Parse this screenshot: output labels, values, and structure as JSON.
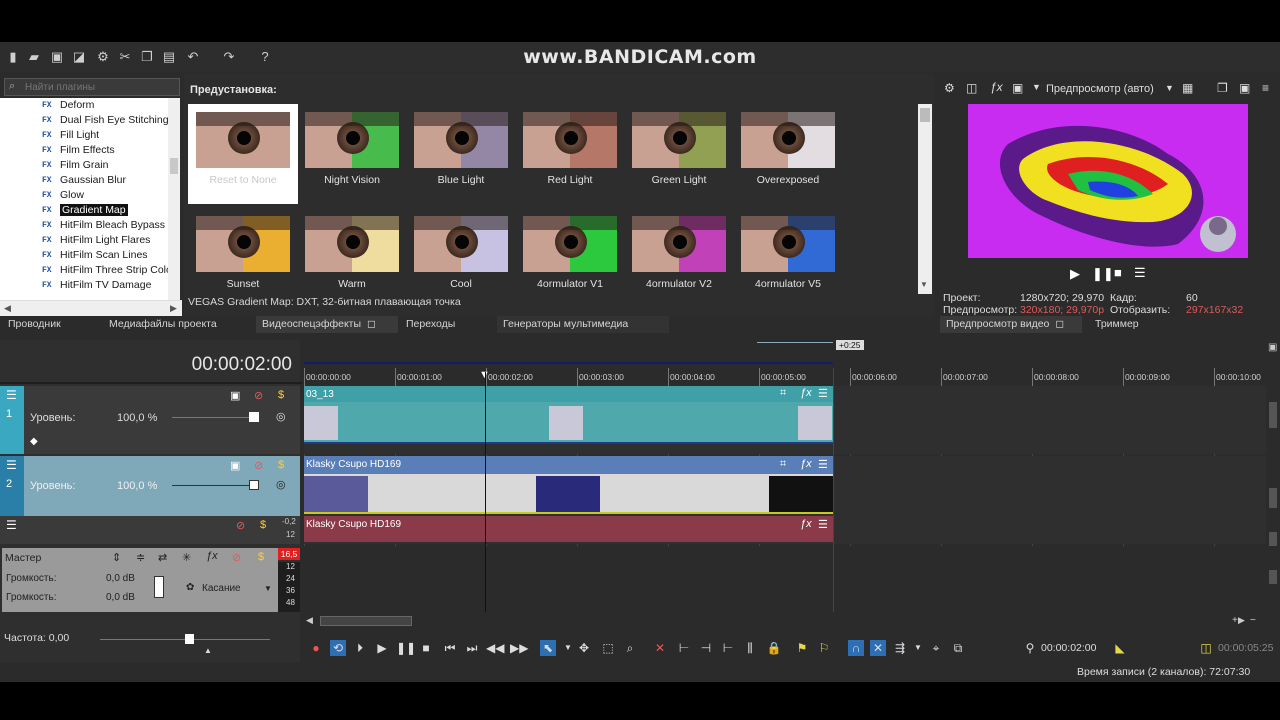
{
  "watermark": "www.BANDICAM.com",
  "plugins": {
    "search_placeholder": "Найти плагины",
    "items": [
      "Deform",
      "Dual Fish Eye Stitching",
      "Fill Light",
      "Film Effects",
      "Film Grain",
      "Gaussian Blur",
      "Glow",
      "Gradient Map",
      "HitFilm Bleach Bypass",
      "HitFilm Light Flares",
      "HitFilm Scan Lines",
      "HitFilm Three Strip Colo",
      "HitFilm TV Damage"
    ],
    "fx_glyph": "FX",
    "selected": "Gradient Map"
  },
  "presets": {
    "title": "Предустановка:",
    "items": [
      {
        "label": "Reset to None",
        "tint": "#c9a192"
      },
      {
        "label": "Night Vision",
        "tint": "#30c040"
      },
      {
        "label": "Blue Light",
        "tint": "#8a82a8"
      },
      {
        "label": "Red  Light",
        "tint": "#b07060"
      },
      {
        "label": "Green  Light",
        "tint": "#88a048"
      },
      {
        "label": "Overexposed",
        "tint": "#e8e8f0"
      },
      {
        "label": "Sunset",
        "tint": "#f0b020"
      },
      {
        "label": "Warm",
        "tint": "#f5e8a0"
      },
      {
        "label": "Cool",
        "tint": "#c8c8f0"
      },
      {
        "label": "4ormulator V1",
        "tint": "#10d030"
      },
      {
        "label": "4ormulator V2",
        "tint": "#c030c0"
      },
      {
        "label": "4ormulator V5",
        "tint": "#1860e0"
      }
    ],
    "status": "VEGAS Gradient Map: DXT, 32-битная плавающая точка"
  },
  "preview": {
    "mode": "Предпросмотр (авто)",
    "project_label": "Проект:",
    "project_value": "1280x720; 29,970",
    "preview_label": "Предпросмотр:",
    "preview_value": "320x180; 29,970p",
    "frame_label": "Кадр:",
    "frame_value": "60",
    "display_label": "Отобразить:",
    "display_value": "297x167x32"
  },
  "tabs": [
    "Проводник",
    "Медиафайлы проекта",
    "Видеоспецэффекты",
    "Переходы",
    "Генераторы мультимедиа",
    "Предпросмотр видео",
    "Триммер"
  ],
  "timeline": {
    "current_time": "00:00:02:00",
    "offset_badge": "+0:25",
    "ruler": [
      "00:00:00:00",
      "00:00:01:00",
      "00:00:02:00",
      "00:00:03:00",
      "00:00:04:00",
      "00:00:05:00",
      "00:00:06:00",
      "00:00:07:00",
      "00:00:08:00",
      "00:00:09:00",
      "00:00:10:00"
    ],
    "tracks": [
      {
        "num": "1",
        "level_label": "Уровень:",
        "level_value": "100,0 %",
        "clip": "03_13"
      },
      {
        "num": "2",
        "level_label": "Уровень:",
        "level_value": "100,0 %",
        "clip": "Klasky Csupo HD169"
      },
      {
        "clip": "Klasky Csupo HD169",
        "db_top": "-0,2",
        "db_bottom": "12"
      }
    ],
    "master": {
      "label": "Мастер",
      "vol1_label": "Громкость:",
      "vol1_value": "0,0 dB",
      "vol2_label": "Громкость:",
      "vol2_value": "0,0 dB",
      "touch": "Касание",
      "peak": "16,5",
      "meter": [
        "12",
        "24",
        "36",
        "48"
      ]
    },
    "rate_label": "Частота: 0,00"
  },
  "transport": {
    "time": "00:00:02:00",
    "end_time": "00:00:05:25"
  },
  "status": "Время записи (2 каналов): 72:07:30"
}
